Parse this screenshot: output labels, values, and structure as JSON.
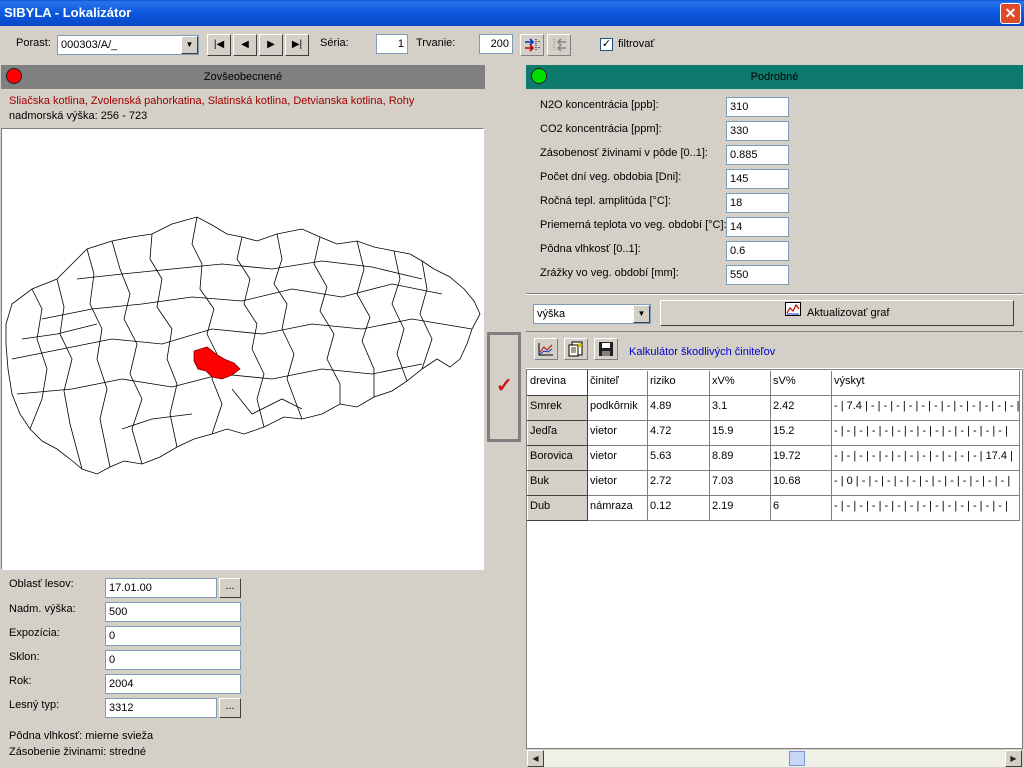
{
  "window": {
    "title": "SIBYLA - Lokalizátor",
    "close_icon": "close-icon"
  },
  "toolbar": {
    "porast_label": "Porast:",
    "porast_value": "000303/A/_",
    "nav_first": "|◀",
    "nav_prev": "◀",
    "nav_next": "▶",
    "nav_last": "▶|",
    "seria_label": "Séria:",
    "seria_value": "1",
    "trvanie_label": "Trvanie:",
    "trvanie_value": "200",
    "filter_label": "filtrovať",
    "filter_checked": "✓"
  },
  "left_panel": {
    "header": "Zovšeobecnené",
    "led_color": "#ff0000",
    "regions": "Sliačska kotlina, Zvolenská pahorkatina, Slatinská kotlina, Detvianska kotlina, Rohy",
    "altitude": "nadmorská výška: 256 - 723",
    "map_highlight_color": "#ff0000",
    "fields": [
      {
        "label": "Oblasť lesov:",
        "value": "17.01.00",
        "has_button": true
      },
      {
        "label": "Nadm. výška:",
        "value": "500",
        "has_button": false
      },
      {
        "label": "Expozícia:",
        "value": "0",
        "has_button": false
      },
      {
        "label": "Sklon:",
        "value": "0",
        "has_button": false
      },
      {
        "label": "Rok:",
        "value": "2004",
        "has_button": false
      },
      {
        "label": "Lesný typ:",
        "value": "3312",
        "has_button": true
      }
    ],
    "ellipsis": "...",
    "footer1": "Pôdna vlhkosť: mierne svieža",
    "footer2": "Zásobenie živinami: stredné"
  },
  "middle": {
    "apply_icon": "checkmark-icon",
    "check_glyph": "✓"
  },
  "right_panel": {
    "header": "Podrobné",
    "led_color": "#00e000",
    "params": [
      {
        "label": "N2O koncentrácia [ppb]:",
        "value": "310"
      },
      {
        "label": "CO2 koncentrácia [ppm]:",
        "value": "330"
      },
      {
        "label": "Zásobenosť živinami v pôde [0..1]:",
        "value": "0.885"
      },
      {
        "label": "Počet dní veg. obdobia [Dni]:",
        "value": "145"
      },
      {
        "label": "Ročná tepl. amplitúda [°C]:",
        "value": "18"
      },
      {
        "label": "Priemerná teplota vo veg. období [°C]:",
        "value": "14"
      },
      {
        "label": "Pôdna vlhkosť [0..1]:",
        "value": "0.6"
      },
      {
        "label": "Zrážky vo veg. období [mm]:",
        "value": "550"
      }
    ],
    "graph_select": "výška",
    "update_button": "Aktualizovať graf",
    "calc_label": "Kalkulátor škodlivých činiteľov",
    "grid": {
      "headers": [
        "drevina",
        "činiteľ",
        "riziko",
        "xV%",
        "sV%",
        "výskyt"
      ],
      "rows": [
        [
          "Smrek",
          "podkôrnik",
          "4.89",
          "3.1",
          "2.42",
          "- | 7.4 | - | - | - | - | - | - | - | - | - | - | - | - |"
        ],
        [
          "Jedľa",
          "vietor",
          "4.72",
          "15.9",
          "15.2",
          "- | - | - | - | - | - | - | - | - | - | - | - | - | - |"
        ],
        [
          "Borovica",
          "vietor",
          "5.63",
          "8.89",
          "19.72",
          "- | - | - | - | - | - | - | - | - | - | - | - | 17.4 |"
        ],
        [
          "Buk",
          "vietor",
          "2.72",
          "7.03",
          "10.68",
          "- | 0 | - | - | - | - | - | - | - | - | - | - | - | - |"
        ],
        [
          "Dub",
          "námraza",
          "0.12",
          "2.19",
          "6",
          "- | - | - | - | - | - | - | - | - | - | - | - | - | - |"
        ]
      ]
    }
  }
}
